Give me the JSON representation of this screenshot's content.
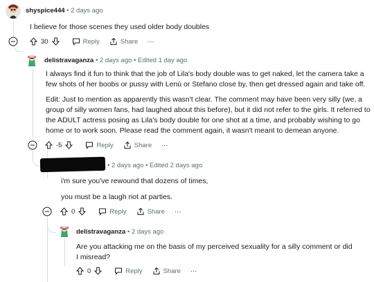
{
  "comments": [
    {
      "username": "shyspice444",
      "sep": "•",
      "time": "2 days ago",
      "text": "I believe for those scenes they used older body doubles",
      "votes": "30",
      "reply": "Reply",
      "share": "Share",
      "more": "···"
    },
    {
      "username": "delistravaganza",
      "sep": "•",
      "time": "2 days ago",
      "edited": "• Edited 1 day ago",
      "paragraph1": "I always find it fun to think that the job of Lila's body double was to get naked, let the camera take a few shots of her boobs or pussy with Lenù or Stefano close by, then get dressed again and take off.",
      "paragraph2": "Edit: Just to mention as apparently this wasn't clear. The comment may have been very silly (we, a group of silly women fans, had laughed about this before), but it did not refer to the girls. It referred to the ADULT actress posing as Lila's body double for one shot at a time, and probably wishing to go home or to work soon. Please read the comment again, it wasn't meant to demean anyone.",
      "votes": "-5",
      "reply": "Reply",
      "share": "Share",
      "more": "···"
    },
    {
      "username": "",
      "meta": "• 2 days ago • Edited 2 days ago",
      "line1": "i'm sure you've rewound that dozens of times,",
      "line2": "you must be a laugh riot at parties.",
      "votes": "0",
      "reply": "Reply",
      "share": "Share",
      "more": "···"
    },
    {
      "username": "delistravaganza",
      "sep": "•",
      "time": "2 days ago",
      "text": "Are you attacking me on the basis of my perceived sexuality for a silly comment or did I misread?",
      "votes": "0",
      "reply": "Reply",
      "share": "Share",
      "more": "···"
    }
  ]
}
